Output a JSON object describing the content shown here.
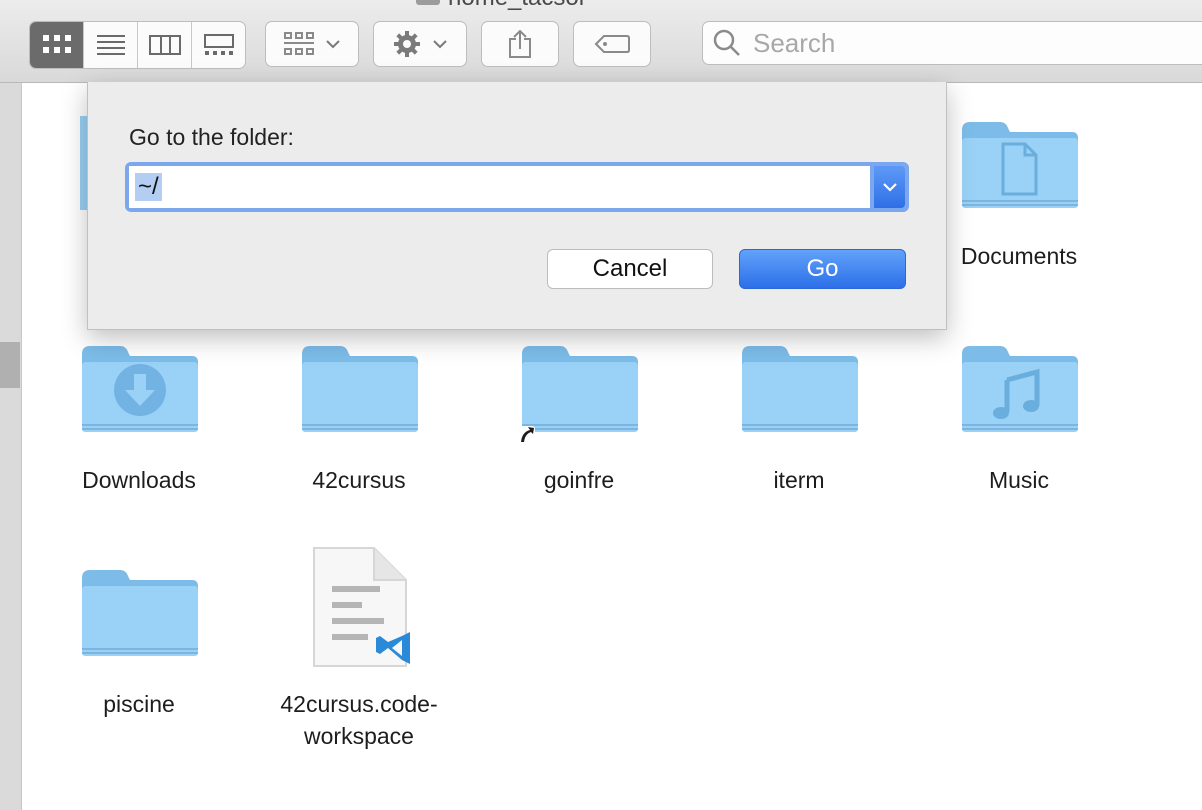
{
  "window": {
    "title_fragment": "home_tacsor"
  },
  "toolbar": {
    "view_modes": [
      "icon-view-icon",
      "list-view-icon",
      "column-view-icon",
      "gallery-view-icon"
    ],
    "active_view": "icon-view-icon",
    "search": {
      "placeholder": "Search"
    }
  },
  "dialog": {
    "label": "Go to the folder:",
    "path_value": "~/",
    "cancel_label": "Cancel",
    "go_label": "Go"
  },
  "files": [
    {
      "name": "Documents",
      "icon": "documents-folder-icon"
    },
    {
      "name": "Downloads",
      "icon": "downloads-folder-icon"
    },
    {
      "name": "42cursus",
      "icon": "folder-icon"
    },
    {
      "name": "goinfre",
      "icon": "alias-folder-icon"
    },
    {
      "name": "iterm",
      "icon": "folder-icon"
    },
    {
      "name": "Music",
      "icon": "music-folder-icon"
    },
    {
      "name": "piscine",
      "icon": "folder-icon"
    },
    {
      "name": "42cursus.code-workspace",
      "line1": "42cursus.code-",
      "line2": "workspace",
      "icon": "vscode-document-icon"
    }
  ],
  "colors": {
    "folder": "#8fc9f2",
    "accent": "#2f6fe6",
    "selection": "#b4cdf3"
  }
}
